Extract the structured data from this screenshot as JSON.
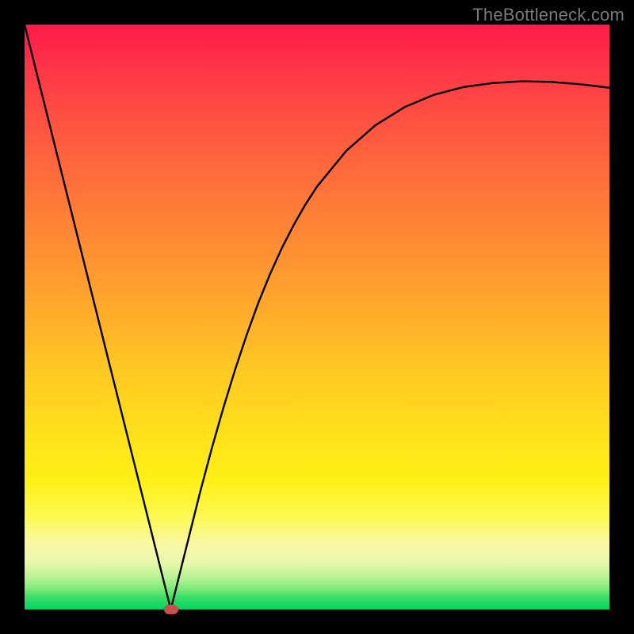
{
  "attribution": "TheBottleneck.com",
  "chart_data": {
    "type": "line",
    "title": "",
    "xlabel": "",
    "ylabel": "",
    "xlim": [
      0,
      100
    ],
    "ylim": [
      0,
      100
    ],
    "x": [
      0,
      2,
      4,
      6,
      8,
      10,
      12,
      14,
      16,
      18,
      20,
      22,
      24,
      25,
      26,
      28,
      30,
      32,
      34,
      36,
      38,
      40,
      42,
      44,
      46,
      48,
      50,
      55,
      60,
      65,
      70,
      75,
      80,
      85,
      90,
      95,
      100
    ],
    "values": [
      100,
      92,
      84,
      76,
      68,
      60,
      52,
      44,
      36,
      28,
      20,
      12,
      4,
      0,
      4,
      12,
      20,
      27.5,
      34.5,
      41,
      47,
      52.5,
      57.4,
      61.8,
      65.7,
      69.2,
      72.3,
      78.4,
      82.8,
      85.9,
      88.0,
      89.3,
      90.0,
      90.3,
      90.2,
      89.8,
      89.2
    ],
    "minimum_marker": {
      "x": 25,
      "y": 0
    },
    "gradient_colors": {
      "top": "#ff1a4b",
      "upper_mid": "#ffa02e",
      "mid": "#ffe11a",
      "lower_mid": "#f8f8a8",
      "bottom": "#00d65f"
    }
  }
}
